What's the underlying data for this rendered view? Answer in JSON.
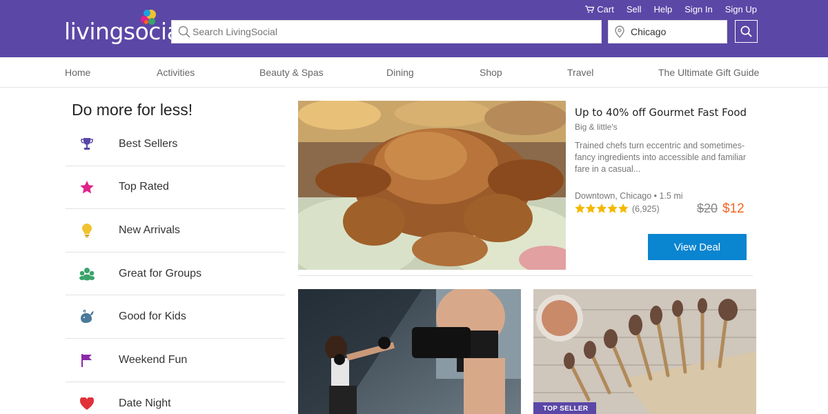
{
  "brand": {
    "name": "livingsocial"
  },
  "top_links": [
    {
      "label": "Cart",
      "icon": "cart-icon"
    },
    {
      "label": "Sell"
    },
    {
      "label": "Help"
    },
    {
      "label": "Sign In"
    },
    {
      "label": "Sign Up"
    }
  ],
  "search": {
    "placeholder": "Search LivingSocial",
    "value": ""
  },
  "location": {
    "value": "Chicago"
  },
  "nav": [
    "Home",
    "Activities",
    "Beauty & Spas",
    "Dining",
    "Shop",
    "Travel",
    "The Ultimate Gift Guide"
  ],
  "sidebar": {
    "title": "Do more for less!",
    "items": [
      {
        "label": "Best Sellers",
        "icon": "trophy-icon",
        "color": "#5b47a6"
      },
      {
        "label": "Top Rated",
        "icon": "star-icon",
        "color": "#e0218a"
      },
      {
        "label": "New Arrivals",
        "icon": "lightbulb-icon",
        "color": "#f2c12e"
      },
      {
        "label": "Great for Groups",
        "icon": "group-icon",
        "color": "#3aa36b"
      },
      {
        "label": "Good for Kids",
        "icon": "whale-icon",
        "color": "#4b7a9a"
      },
      {
        "label": "Weekend Fun",
        "icon": "flag-icon",
        "color": "#8b2aa8"
      },
      {
        "label": "Date Night",
        "icon": "heart-icon",
        "color": "#e0313a"
      }
    ]
  },
  "featured": {
    "title": "Up to 40% off Gourmet Fast Food",
    "merchant": "Big & little's",
    "description": "Trained chefs turn eccentric and sometimes-fancy ingredients into accessible and familiar fare in a casual...",
    "location": "Downtown, Chicago • 1.5 mi",
    "rating": 5,
    "rating_count": "(6,925)",
    "price_old": "$20",
    "price_new": "$12",
    "cta": "View Deal"
  },
  "cards": [
    {
      "image": "kickboxing-photo"
    },
    {
      "image": "makeup-brushes-photo",
      "badge": "TOP SELLER"
    }
  ],
  "colors": {
    "header": "#5b47a6",
    "button": "#0a85d0",
    "price": "#f26522",
    "stars": "#f5b800"
  }
}
